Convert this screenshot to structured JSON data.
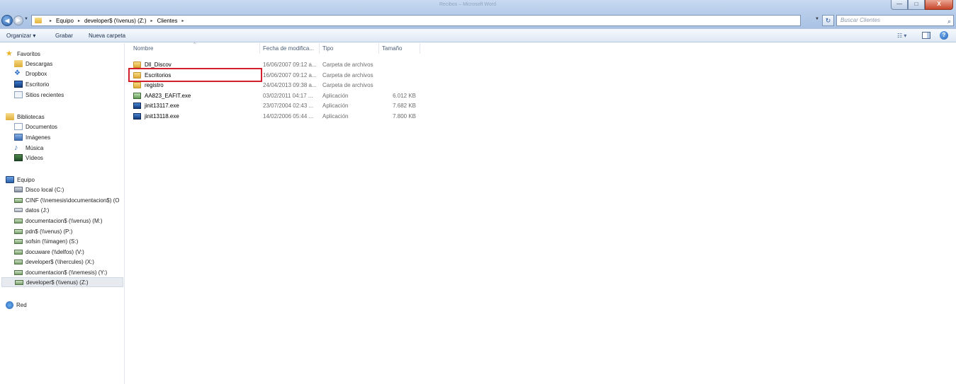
{
  "window": {
    "title": "Recibos – Microsoft Word",
    "controls": {
      "minimize": "—",
      "maximize": "□",
      "close": "X"
    }
  },
  "nav": {
    "back": "◀",
    "forward": "▶",
    "history": "▼"
  },
  "address": {
    "crumbs": [
      "Equipo",
      "developer$ (\\\\venus) (Z:)",
      "Clientes"
    ],
    "separator": "▸",
    "dropdown": "▼"
  },
  "refresh": "↻",
  "search": {
    "placeholder": "Buscar Clientes",
    "icon": "search-icon"
  },
  "toolbar": {
    "organize": "Organizar ▾",
    "burn": "Grabar",
    "new_folder": "Nueva carpeta",
    "view": "☷ ▾",
    "help": "?"
  },
  "sidebar": {
    "favorites": {
      "label": "Favoritos",
      "items": [
        "Descargas",
        "Dropbox",
        "Escritorio",
        "Sitios recientes"
      ]
    },
    "libraries": {
      "label": "Bibliotecas",
      "items": [
        "Documentos",
        "Imágenes",
        "Música",
        "Vídeos"
      ]
    },
    "computer": {
      "label": "Equipo",
      "items": [
        "Disco local (C:)",
        "CINF (\\\\nemesis\\documentacion$) (O",
        "datos (J:)",
        "documentacion$ (\\\\venus) (M:)",
        "pdn$ (\\\\venus) (P:)",
        "sofsin (\\\\imagen) (S:)",
        "docuware (\\\\delfos) (V:)",
        "developer$ (\\\\hercules) (X:)",
        "documentacion$ (\\\\nemesis) (Y:)",
        "developer$ (\\\\venus) (Z:)"
      ]
    },
    "network": {
      "label": "Red"
    }
  },
  "columns": {
    "name": "Nombre",
    "date": "Fecha de modifica...",
    "type": "Tipo",
    "size": "Tamaño",
    "sort": "^"
  },
  "files": [
    {
      "name": "Dll_Discov",
      "date": "16/06/2007 09:12 a...",
      "type": "Carpeta de archivos",
      "size": ""
    },
    {
      "name": "Escritorios",
      "date": "16/06/2007 09:12 a...",
      "type": "Carpeta de archivos",
      "size": ""
    },
    {
      "name": "registro",
      "date": "24/04/2013 09:38 a...",
      "type": "Carpeta de archivos",
      "size": ""
    },
    {
      "name": "AA823_EAFIT.exe",
      "date": "03/02/2011 04:17 ...",
      "type": "Aplicación",
      "size": "6.012 KB"
    },
    {
      "name": "jinit13117.exe",
      "date": "23/07/2004 02:43 ...",
      "type": "Aplicación",
      "size": "7.682 KB"
    },
    {
      "name": "jinit13118.exe",
      "date": "14/02/2006 05:44 ...",
      "type": "Aplicación",
      "size": "7.800 KB"
    }
  ],
  "colors": {
    "highlight": "#d3202c",
    "titlebar": "#b7cdea"
  }
}
